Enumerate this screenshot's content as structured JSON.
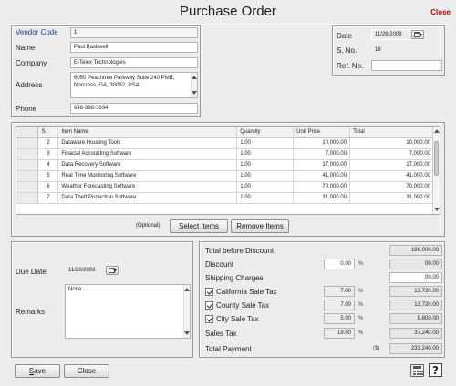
{
  "window": {
    "title": "Purchase Order",
    "close_label": "Close"
  },
  "vendor": {
    "code_label": "Vendor Code",
    "code_value": "1",
    "name_label": "Name",
    "name_value": "Paul Baskwell",
    "company_label": "Company",
    "company_value": "E-Telex Technologies",
    "address_label": "Address",
    "address_line1": "6050 Peachtree Parkway Suite 240 PMB,",
    "address_line2": "Norcross, GA, 30092, USA",
    "phone_label": "Phone",
    "phone_value": "648-388-3834"
  },
  "order": {
    "date_label": "Date",
    "date_value": "11/26/2008",
    "sno_label": "S. No.",
    "sno_value": "18",
    "refno_label": "Ref. No.",
    "refno_value": ""
  },
  "items": {
    "headers": [
      "S.",
      "Item Name",
      "Quantity",
      "Unit Price",
      "Total"
    ],
    "rows": [
      {
        "s": "2",
        "name": "Dataware Housing Tools",
        "qty": "1.00",
        "price": "10,000.00",
        "total": "10,000.00"
      },
      {
        "s": "3",
        "name": "Finacial Accounting Software",
        "qty": "1.00",
        "price": "7,000.00",
        "total": "7,000.00"
      },
      {
        "s": "4",
        "name": "Data Recovery Software",
        "qty": "1.00",
        "price": "17,000.00",
        "total": "17,000.00"
      },
      {
        "s": "5",
        "name": "Real Time Monitoring Software",
        "qty": "1.00",
        "price": "41,000.00",
        "total": "41,000.00"
      },
      {
        "s": "6",
        "name": "Weather Forecasting Software",
        "qty": "1.00",
        "price": "70,000.00",
        "total": "70,000.00"
      },
      {
        "s": "7",
        "name": "Data Theft Protection Software",
        "qty": "1.00",
        "price": "31,000.00",
        "total": "31,000.00"
      }
    ],
    "optional_label": "(Optional)",
    "select_label": "Select Items",
    "remove_label": "Remove Items"
  },
  "footer_left": {
    "due_date_label": "Due Date",
    "due_date_value": "11/26/2008",
    "remarks_label": "Remarks",
    "remarks_value": "None"
  },
  "totals": {
    "before_discount_label": "Total before Discount",
    "before_discount_value": "196,000.00",
    "discount_label": "Discount",
    "discount_pct": "0.00",
    "discount_value": "00.00",
    "shipping_label": "Shipping Charges",
    "shipping_value": "00.00",
    "ca_tax_label": "California Sale Tax",
    "ca_tax_pct": "7.00",
    "ca_tax_value": "13,720.00",
    "county_tax_label": "County Sale Tax",
    "county_tax_pct": "7.00",
    "county_tax_value": "13,720.00",
    "city_tax_label": "City Sale Tax",
    "city_tax_pct": "5.00",
    "city_tax_value": "9,800.00",
    "sales_tax_label": "Sales Tax",
    "sales_tax_pct": "19.00",
    "sales_tax_value": "37,240.00",
    "total_label": "Total Payment",
    "total_currency": "($)",
    "total_value": "233,240.00",
    "pct_symbol": "%"
  },
  "buttons": {
    "save_underlined": "S",
    "save_rest": "ave",
    "close_label": "Close"
  },
  "icons": [
    "calculator-icon",
    "help-icon",
    "calendar-icon",
    "dropdown-arrow-icon",
    "checkbox-checked-icon"
  ]
}
